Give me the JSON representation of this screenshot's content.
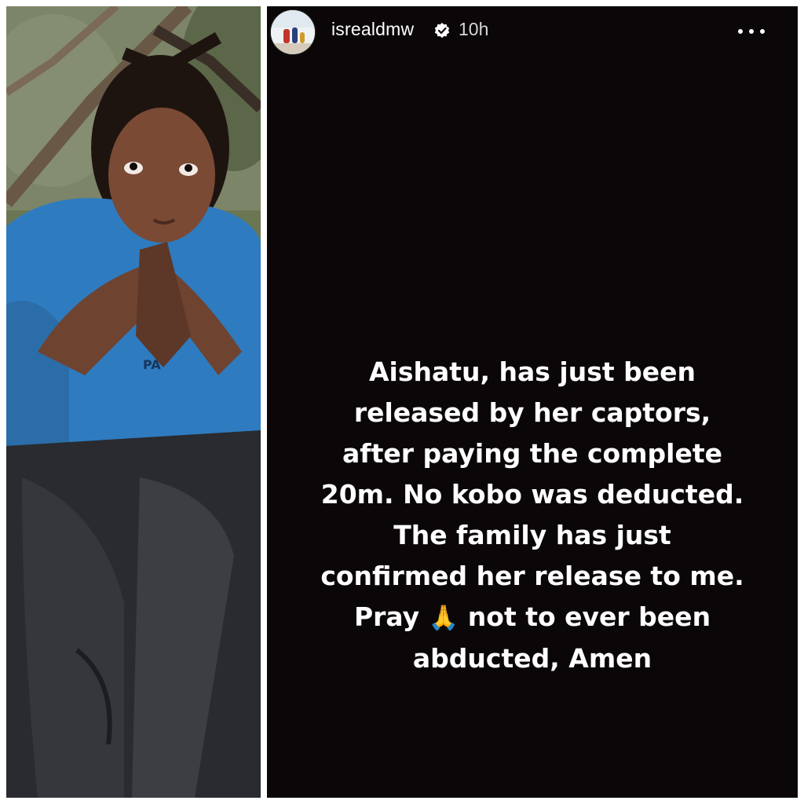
{
  "story": {
    "username": "isrealdmw",
    "time_ago": "10h",
    "more_label": "More options",
    "lines": [
      "Aishatu, has just been",
      "released by her captors,",
      "after paying the complete",
      "20m. No kobo was deducted.",
      "The family  has just",
      "confirmed her release to me."
    ],
    "pray_word": "Pray",
    "pray_emoji": "🙏",
    "pray_rest": "not to ever been",
    "last_line": "abducted, Amen"
  },
  "photo": {
    "shirt_text": "PA"
  },
  "icons": {
    "verified": "verified-badge-icon",
    "more": "more-dots-icon",
    "pray": "praying-hands-icon"
  },
  "colors": {
    "story_background": "#0b0709",
    "text": "#ffffff",
    "secondary_text": "#d8d6d7",
    "shirt": "#2f7bbf",
    "pants": "#2a2b30",
    "foliage": "#5b6b4a"
  }
}
